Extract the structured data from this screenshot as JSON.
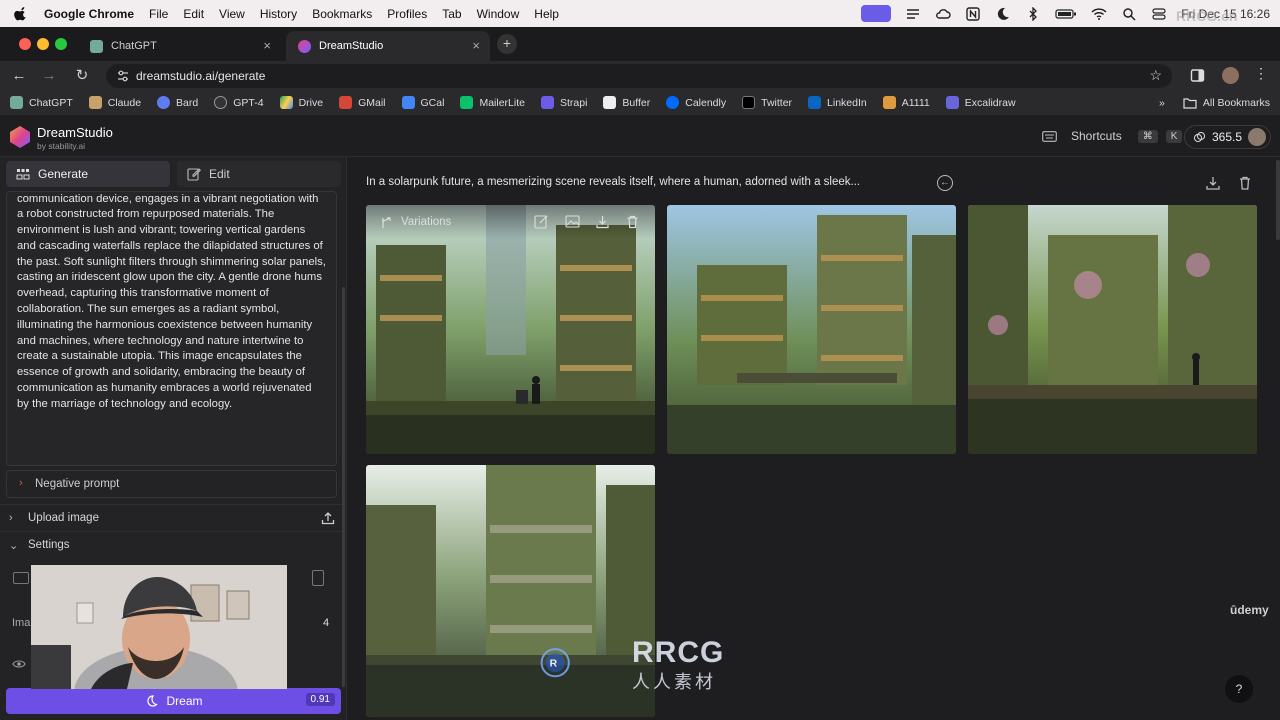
{
  "menubar": {
    "app": "Google Chrome",
    "items": [
      "File",
      "Edit",
      "View",
      "History",
      "Bookmarks",
      "Profiles",
      "Tab",
      "Window",
      "Help"
    ],
    "clock": "Fri Dec 15 16:26"
  },
  "tabs": [
    {
      "label": "ChatGPT",
      "active": false
    },
    {
      "label": "DreamStudio",
      "active": true
    }
  ],
  "address": {
    "url": "dreamstudio.ai/generate"
  },
  "bookmarks": [
    "ChatGPT",
    "Claude",
    "Bard",
    "GPT-4",
    "Drive",
    "GMail",
    "GCal",
    "MailerLite",
    "Strapi",
    "Buffer",
    "Calendly",
    "Twitter",
    "LinkedIn",
    "A1111",
    "Excalidraw"
  ],
  "bookmarks_more": "»",
  "all_bookmarks": "All Bookmarks",
  "app": {
    "brand": "DreamStudio",
    "brand_sub": "by stability.ai",
    "shortcuts_label": "Shortcuts",
    "shortcut_keys": [
      "⌘",
      "K"
    ],
    "credits": "365.5"
  },
  "left": {
    "tab_generate": "Generate",
    "tab_edit": "Edit",
    "prompt_text": "communication device, engages in a vibrant negotiation with a robot constructed from repurposed materials. The environment is lush and vibrant; towering vertical gardens and cascading waterfalls replace the dilapidated structures of the past. Soft sunlight filters through shimmering solar panels, casting an iridescent glow upon the city. A gentle drone hums overhead, capturing this transformative moment of collaboration. The sun emerges as a radiant symbol, illuminating the harmonious coexistence between humanity and machines, where technology and nature intertwine to create a sustainable utopia. This image encapsulates the essence of growth and solidarity, embracing the beauty of communication as humanity embraces a world rejuvenated by the marriage of technology and ecology.",
    "negative_prompt": "Negative prompt",
    "upload_image": "Upload image",
    "settings": "Settings",
    "settings_partial_label": "Ima",
    "image_count": "4",
    "dream_label": "Dream",
    "dream_cost": "0.91"
  },
  "main": {
    "prompt_title": "In a solarpunk future, a mesmerizing scene reveals itself, where a human, adorned with a sleek...",
    "overlay_label": "Variations",
    "udemy": "ūdemy",
    "help": "?"
  },
  "watermark": {
    "title": "RRCG",
    "subtitle": "人人素材",
    "corner": "RRCG.cn"
  },
  "colors": {
    "accent": "#6d4fe6",
    "panel": "#232325",
    "bg": "#1e1e20"
  }
}
